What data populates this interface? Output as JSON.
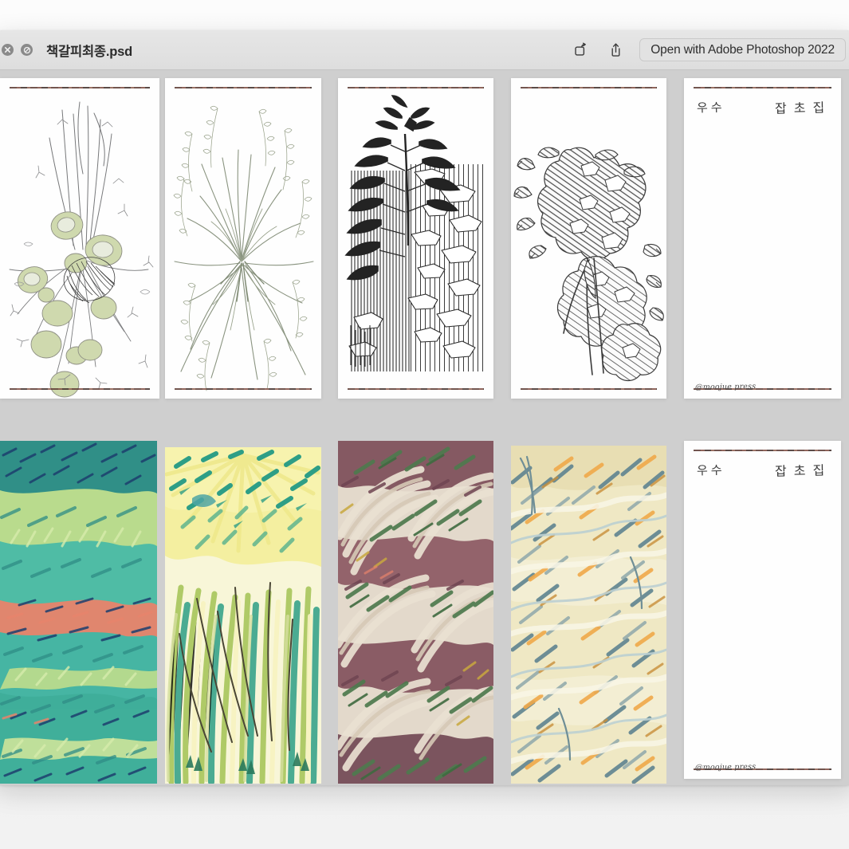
{
  "window": {
    "title": "책갈피최종.psd",
    "background_color": "#cfcfcf",
    "titlebar_color": "#e2e2e2"
  },
  "titlebar": {
    "buttons": [
      {
        "name": "close-button",
        "icon": "close-icon",
        "label": ""
      },
      {
        "name": "disabled-button",
        "icon": "no-entry-icon",
        "label": ""
      }
    ],
    "markup_icon": "rotate-markup-icon",
    "share_icon": "share-icon",
    "open_with_label": "Open with Adobe Photoshop 2022"
  },
  "gallery": {
    "rows": [
      {
        "name": "line-art-row",
        "panels": [
          {
            "id": "panel-1",
            "kind": "lineart",
            "subject": "round-leaf-plant-sketch",
            "ink": "#6a6a6a",
            "accent": "#b9c49a"
          },
          {
            "id": "panel-2",
            "kind": "lineart",
            "subject": "grass-sedge-sketch",
            "ink": "#7a8270",
            "accent": "#93a184"
          },
          {
            "id": "panel-3",
            "kind": "lineart",
            "subject": "vertical-hatch-fern-sketch",
            "ink": "#3a3a3a",
            "accent": "#2d2d2d"
          },
          {
            "id": "panel-4",
            "kind": "lineart",
            "subject": "diagonal-hatch-branch-sketch",
            "ink": "#4a4a4a",
            "accent": "#5c5c5c"
          },
          {
            "id": "panel-5",
            "kind": "label",
            "subject": "bookmark-title-card",
            "hand_left": "우수",
            "hand_right": "잡초집",
            "signature": "@moojue press"
          }
        ]
      },
      {
        "name": "color-art-row",
        "panels": [
          {
            "id": "panel-6",
            "kind": "color",
            "subject": "teal-green-foliage",
            "palette": [
              "#3fae9a",
              "#57bfa6",
              "#bdd98a",
              "#e8826a",
              "#1d3f6e",
              "#2f7f78"
            ]
          },
          {
            "id": "panel-7",
            "kind": "color",
            "subject": "yellow-sunburst-grass",
            "palette": [
              "#f2ee96",
              "#f7f2a8",
              "#2e9e86",
              "#9ec04b",
              "#3f8f7d",
              "#5a4a32"
            ]
          },
          {
            "id": "panel-8",
            "kind": "color",
            "subject": "mauve-cream-pampas",
            "palette": [
              "#e6ddd0",
              "#8a5560",
              "#6f4552",
              "#4e7a4e",
              "#d9cdb8",
              "#c9a83f"
            ]
          },
          {
            "id": "panel-9",
            "kind": "color",
            "subject": "cream-orange-slate-grass",
            "palette": [
              "#efe8c4",
              "#f0a94a",
              "#5f8490",
              "#8fa8ab",
              "#f7f3dc",
              "#c98f3a"
            ]
          },
          {
            "id": "panel-10",
            "kind": "label",
            "subject": "bookmark-title-card",
            "hand_left": "우수",
            "hand_right": "잡초집",
            "signature": "@moojue press"
          }
        ]
      }
    ]
  }
}
